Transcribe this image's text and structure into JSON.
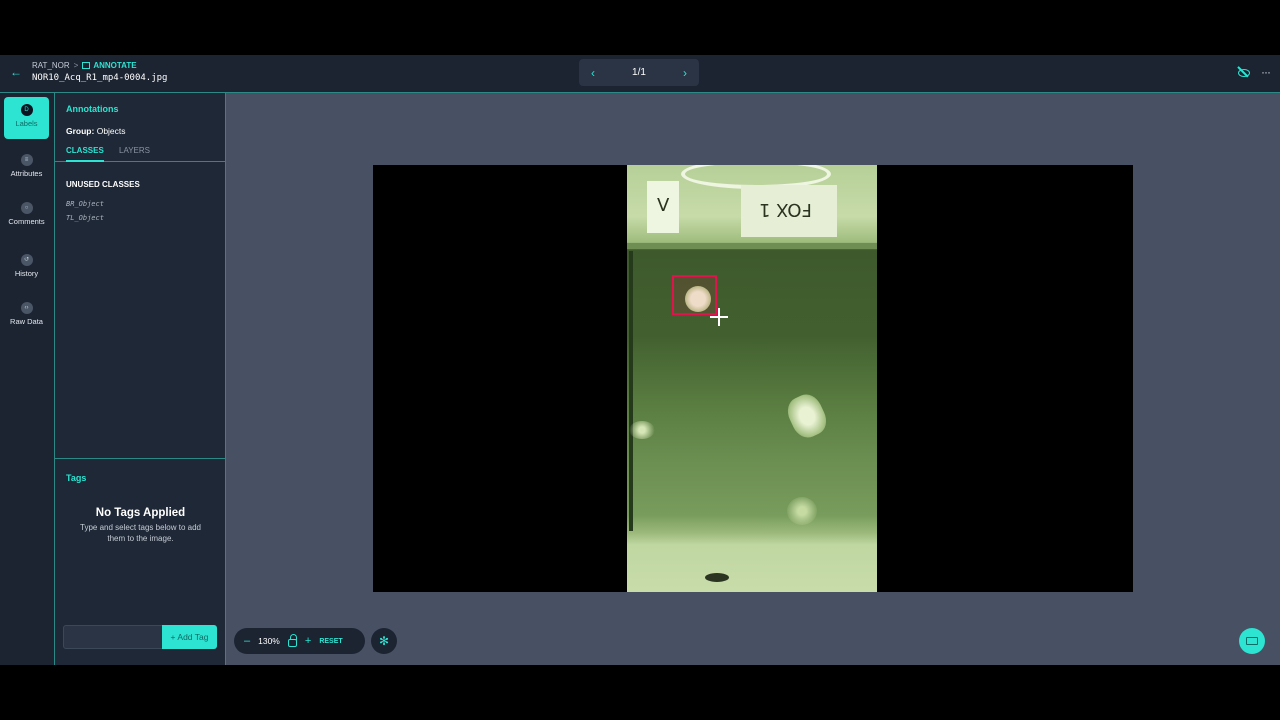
{
  "header": {
    "breadcrumb_project": "RAT_NOR",
    "breadcrumb_sep": ">",
    "breadcrumb_mode": "ANNOTATE",
    "filename": "NOR10_Acq_R1_mp4-0004.jpg",
    "pager": "1/1"
  },
  "rail": {
    "items": [
      {
        "label": "Labels",
        "icon": "labels-icon"
      },
      {
        "label": "Attributes",
        "icon": "list-icon"
      },
      {
        "label": "Comments",
        "icon": "comment-icon"
      },
      {
        "label": "History",
        "icon": "history-icon"
      },
      {
        "label": "Raw Data",
        "icon": "code-icon"
      }
    ]
  },
  "panel": {
    "title": "Annotations",
    "group_label": "Group:",
    "group_value": "Objects",
    "tabs": [
      "CLASSES",
      "LAYERS"
    ],
    "unused_header": "UNUSED CLASSES",
    "classes": [
      "BR_Object",
      "TL_Object"
    ],
    "tags_title": "Tags",
    "no_tags": "No Tags Applied",
    "no_tags_sub": "Type and select tags below to add them to the image.",
    "tag_input_placeholder": "",
    "add_tag": "+ Add Tag"
  },
  "canvas": {
    "card_left_text": "V",
    "card_right_text": "FOX 1",
    "zoom": "130%",
    "zoom_out": "–",
    "zoom_in": "+",
    "reset": "RESET"
  },
  "colors": {
    "accent": "#2de3d1",
    "bbox": "#e0144c",
    "background": "#1f2836",
    "canvas": "#475163"
  }
}
